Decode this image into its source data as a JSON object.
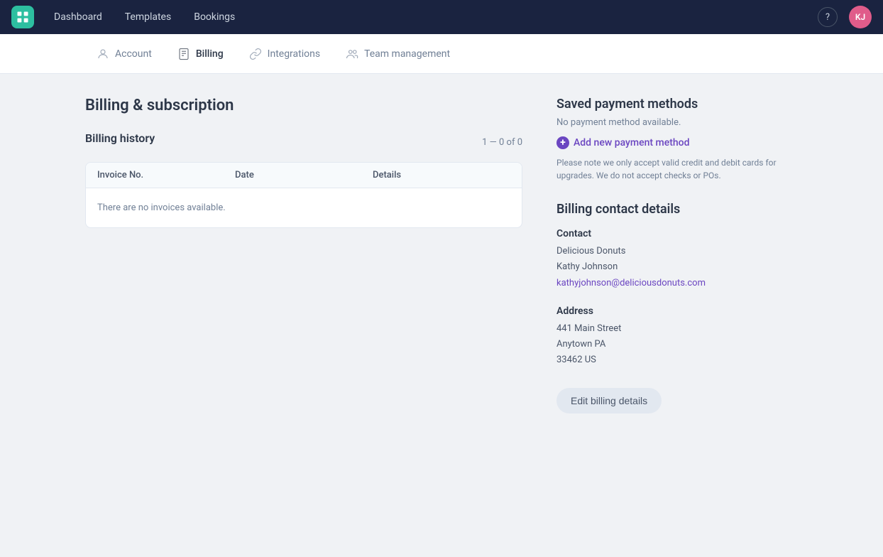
{
  "nav": {
    "logo_alt": "Workforce Logo",
    "links": [
      "Dashboard",
      "Templates",
      "Bookings"
    ],
    "help_label": "?",
    "avatar_initials": "KJ"
  },
  "sub_nav": {
    "items": [
      {
        "id": "account",
        "label": "Account",
        "icon": "person"
      },
      {
        "id": "billing",
        "label": "Billing",
        "icon": "receipt",
        "active": true
      },
      {
        "id": "integrations",
        "label": "Integrations",
        "icon": "link"
      },
      {
        "id": "team",
        "label": "Team management",
        "icon": "group"
      }
    ]
  },
  "main": {
    "page_title": "Billing & subscription",
    "billing_history": {
      "section_label": "Billing history",
      "pagination": "1 — 0 of 0",
      "table": {
        "columns": [
          "Invoice No.",
          "Date",
          "Details"
        ],
        "empty_message": "There are no invoices available."
      }
    },
    "payment_methods": {
      "heading": "Saved payment methods",
      "no_payment_text": "No payment method available.",
      "add_link_label": "Add new payment method",
      "note": "Please note we only accept valid credit and debit cards for upgrades. We do not accept checks or POs."
    },
    "billing_contact": {
      "heading": "Billing contact details",
      "contact_label": "Contact",
      "company_name": "Delicious Donuts",
      "contact_name": "Kathy Johnson",
      "contact_email": "kathyjohnson@deliciousdonuts.com",
      "address_label": "Address",
      "address_line1": "441 Main Street",
      "address_line2": "Anytown PA",
      "address_line3": "33462 US",
      "edit_button_label": "Edit billing details"
    }
  }
}
